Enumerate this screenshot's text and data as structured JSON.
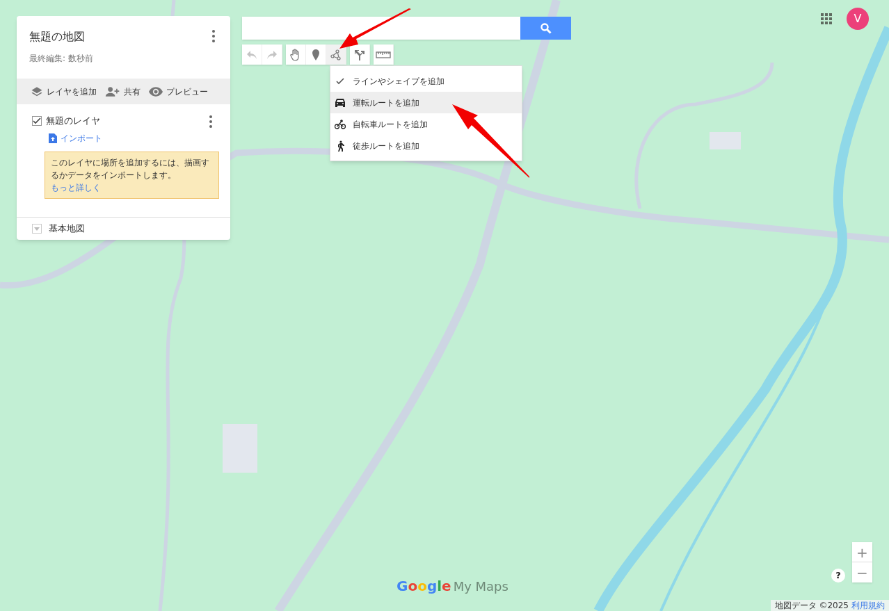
{
  "map_panel": {
    "title": "無題の地図",
    "subtitle": "最終編集: 数秒前",
    "actions": [
      {
        "kind": "layers",
        "label": "レイヤを追加"
      },
      {
        "kind": "share",
        "label": "共有"
      },
      {
        "kind": "preview",
        "label": "プレビュー"
      }
    ],
    "layer": {
      "name": "無題のレイヤ",
      "checked": true,
      "import_label": "インポート",
      "tip": "このレイヤに場所を追加するには、描画するかデータをインポートします。",
      "tip_link": "もっと詳しく"
    },
    "base_map": {
      "label": "基本地図",
      "expanded": false
    }
  },
  "toolbar": [
    {
      "kind": "undo",
      "disabled": true,
      "selected": false
    },
    {
      "kind": "redo",
      "disabled": true,
      "selected": false
    },
    {
      "kind": "hand",
      "disabled": false,
      "selected": false
    },
    {
      "kind": "marker",
      "disabled": false,
      "selected": false
    },
    {
      "kind": "line",
      "disabled": false,
      "selected": true
    },
    {
      "kind": "directions",
      "disabled": false,
      "selected": false
    },
    {
      "kind": "ruler",
      "disabled": false,
      "selected": false
    }
  ],
  "draw_menu": [
    {
      "kind": "shape",
      "label": "ラインやシェイプを追加",
      "checked": true,
      "highlighted": false
    },
    {
      "kind": "car",
      "label": "運転ルートを追加",
      "checked": false,
      "highlighted": true
    },
    {
      "kind": "bike",
      "label": "自転車ルートを追加",
      "checked": false,
      "highlighted": false
    },
    {
      "kind": "walk",
      "label": "徒歩ルートを追加",
      "checked": false,
      "highlighted": false
    }
  ],
  "account": {
    "initial": "V"
  },
  "logo": {
    "brand": "Google",
    "product": "My Maps"
  },
  "attribution": {
    "data": "地図データ ©2025",
    "terms": "利用規約"
  },
  "zoom": {
    "in": "+",
    "out": "−"
  },
  "help": "?"
}
